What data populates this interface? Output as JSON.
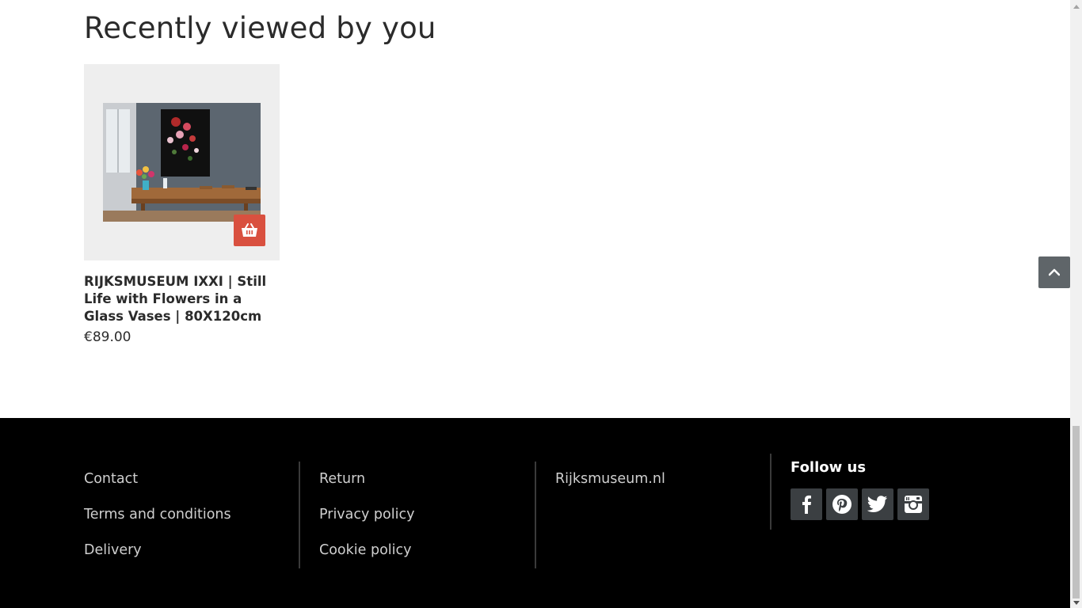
{
  "recent": {
    "title": "Recently viewed by you"
  },
  "product": {
    "title": "RIJKSMUSEUM IXXI | Still Life with Flowers in a Glass Vases | 80X120cm",
    "price": "€89.00",
    "image_alt": "Still life with flowers painting displayed above a dining table",
    "cart_icon": "shopping-basket-icon"
  },
  "footer": {
    "col1": [
      "Contact",
      "Terms and conditions",
      "Delivery"
    ],
    "col2": [
      "Return",
      "Privacy policy",
      "Cookie policy"
    ],
    "col3": [
      "Rijksmuseum.nl"
    ],
    "follow_title": "Follow us",
    "social": [
      "facebook-icon",
      "pinterest-icon",
      "twitter-icon",
      "instagram-icon"
    ]
  },
  "colors": {
    "accent": "#d9503f",
    "footer_bg": "#000000",
    "social_bg": "#3b3f42",
    "back_to_top_bg": "#5f6569"
  }
}
